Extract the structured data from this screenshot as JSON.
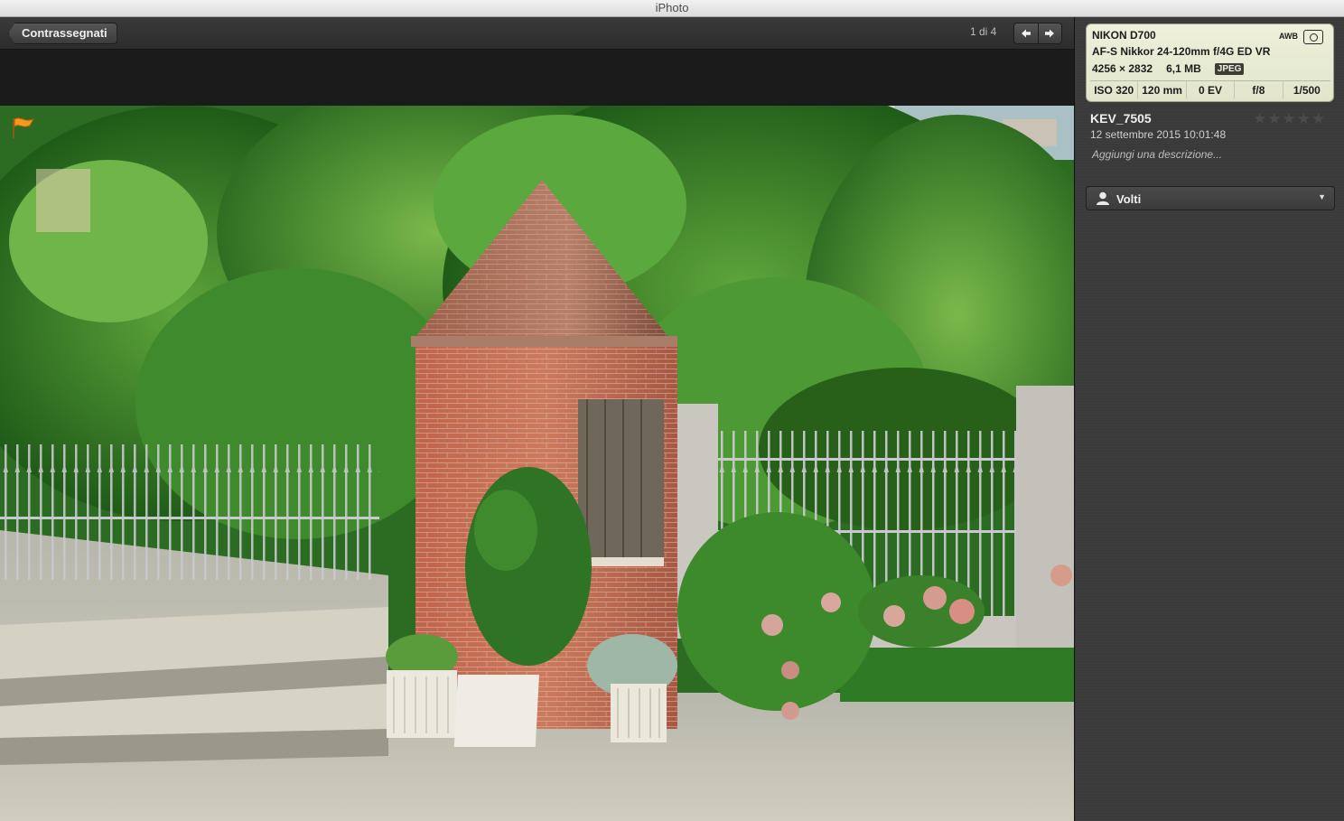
{
  "app": {
    "title": "iPhoto"
  },
  "toolbar": {
    "back_label": "Contrassegnati",
    "counter": "1 di 4"
  },
  "photo_info": {
    "camera": "NIKON D700",
    "lens": "AF-S Nikkor 24-120mm f/4G ED VR",
    "dimensions": "4256 × 2832",
    "size": "6,1 MB",
    "format": "JPEG",
    "white_balance": "AWB",
    "metering_icon": "matrix-metering-icon",
    "iso": "ISO 320",
    "focal": "120 mm",
    "exposure_comp": "0 EV",
    "aperture": "f/8",
    "shutter": "1/500"
  },
  "photo": {
    "title": "KEV_7505",
    "date": "12 settembre 2015 10:01:48",
    "description_placeholder": "Aggiungi una descrizione...",
    "rating": 0,
    "rating_max": 5,
    "flagged": true
  },
  "faces": {
    "label": "Volti"
  },
  "colors": {
    "flag": "#f39a1c",
    "exif_bg": "#e6e9d0",
    "sidebar_bg": "#3a3a3a"
  }
}
